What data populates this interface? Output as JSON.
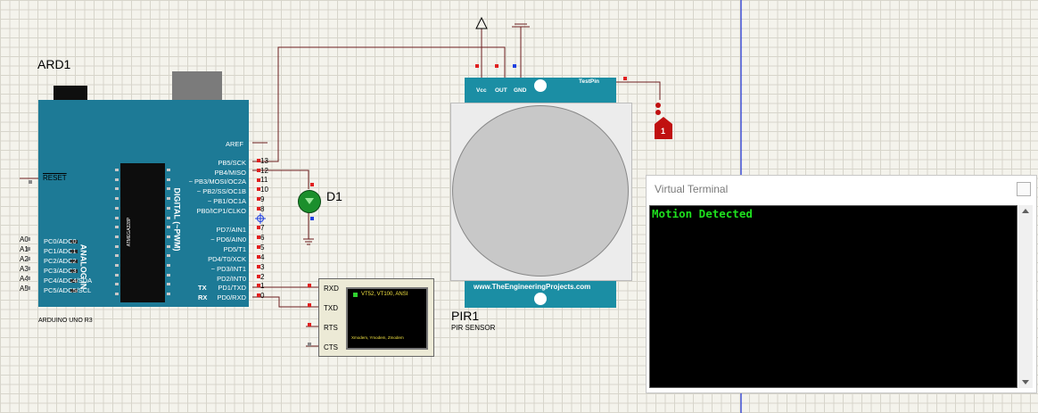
{
  "arduino": {
    "ref": "ARD1",
    "model": "ARDUINO UNO R3",
    "chip": "ATMEGA328P",
    "reset_label": "RESET",
    "analog_in_label": "ANALOG IN",
    "digital_label": "DIGITAL (~PWM)",
    "aref_label": "AREF",
    "tx_label": "TX",
    "rx_label": "RX",
    "analog_pins": [
      "A0",
      "A1",
      "A2",
      "A3",
      "A4",
      "A5"
    ],
    "analog_labels": [
      "PC0/ADC0",
      "PC1/ADC1",
      "PC2/ADC2",
      "PC3/ADC3",
      "PC4/ADC4/SDA",
      "PC5/ADC5/SCL"
    ],
    "digital_labels": [
      "PB5/SCK",
      "PB4/MISO",
      "~ PB3/MOSI/OC2A",
      "~ PB2/SS/OC1B",
      "~ PB1/OC1A",
      "PB0/ICP1/CLKO",
      "PD7/AIN1",
      "~ PD6/AIN0",
      "PD5/T1",
      "PD4/T0/XCK",
      "~ PD3/INT1",
      "PD2/INT0",
      "PD1/TXD",
      "PD0/RXD"
    ],
    "digital_numbers": [
      "13",
      "12",
      "11",
      "10",
      "9",
      "8",
      "7",
      "6",
      "5",
      "4",
      "3",
      "2",
      "1",
      "0"
    ]
  },
  "led": {
    "ref": "D1"
  },
  "pir": {
    "ref": "PIR1",
    "type": "PIR SENSOR",
    "pins": [
      "Vcc",
      "OUT",
      "GND"
    ],
    "testpin": "TestPin",
    "website": "www.TheEngineeringProjects.com"
  },
  "logicstate": {
    "value": "1"
  },
  "vt_small": {
    "pins": [
      "RXD",
      "TXD",
      "RTS",
      "CTS"
    ],
    "line1": "VT52, VT100, ANSI",
    "line2": "Xmodem, Ymodem, Zmodem"
  },
  "vt_window": {
    "title": "Virtual Terminal",
    "output": "Motion Detected"
  },
  "colors": {
    "board": "#1d7a96",
    "pir_board": "#1b8ea4",
    "terminal_text": "#1ee01e",
    "wire": "#6b1e1e"
  }
}
